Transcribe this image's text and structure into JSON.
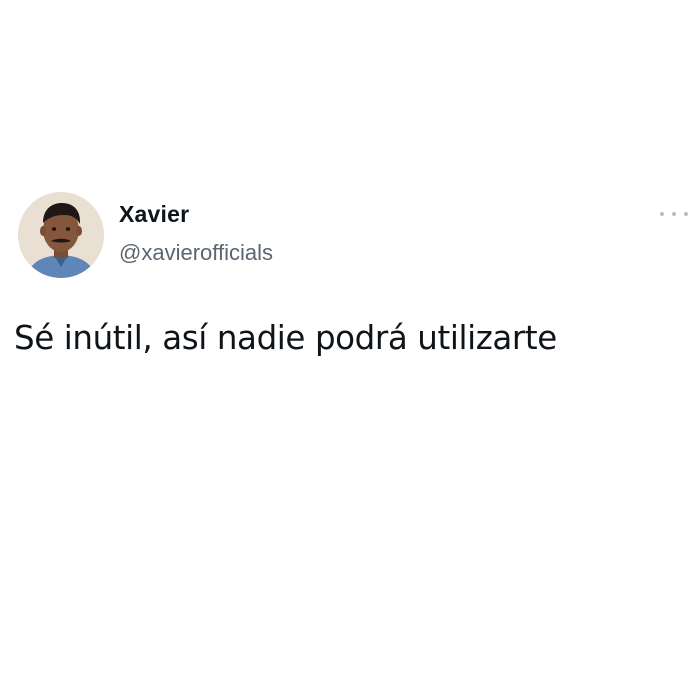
{
  "tweet": {
    "author": {
      "display_name": "Xavier",
      "handle": "@xavierofficials",
      "avatar_icon": "profile-photo"
    },
    "more_icon": "ellipsis-icon",
    "text": "Sé inútil, así nadie podrá utilizarte"
  }
}
